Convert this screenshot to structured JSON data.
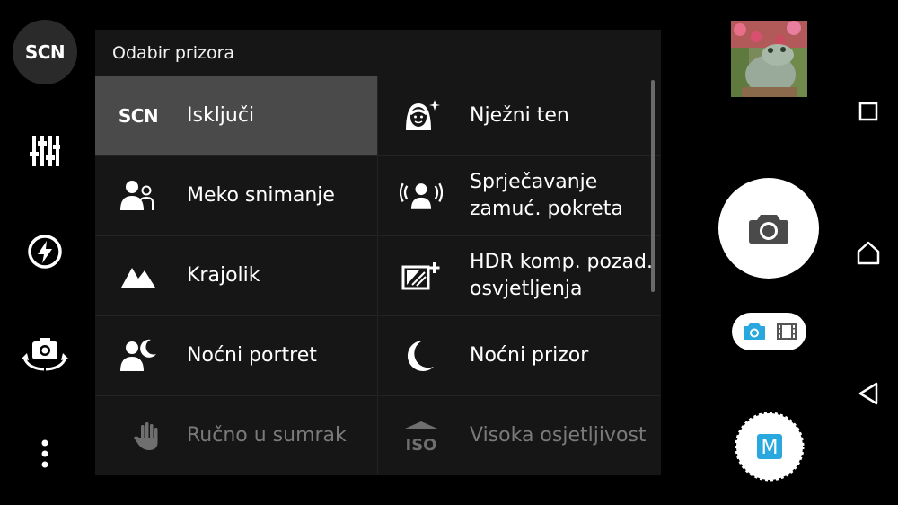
{
  "left_rail": {
    "scene_button_label": "SCN",
    "items": [
      {
        "icon": "sliders-icon"
      },
      {
        "icon": "flash-auto-icon"
      },
      {
        "icon": "switch-camera-icon"
      },
      {
        "icon": "more-vertical-icon"
      }
    ]
  },
  "scene_panel": {
    "title": "Odabir prizora",
    "scenes": [
      {
        "icon": "scn-text-icon",
        "icon_text": "SCN",
        "label": "Isključi",
        "selected": true,
        "enabled": true
      },
      {
        "icon": "soft-skin-icon",
        "label": "Nježni ten",
        "selected": false,
        "enabled": true
      },
      {
        "icon": "soft-snap-icon",
        "label": "Meko snimanje",
        "selected": false,
        "enabled": true
      },
      {
        "icon": "anti-motion-blur-icon",
        "label": "Sprječavanje zamuć. pokreta",
        "selected": false,
        "enabled": true
      },
      {
        "icon": "landscape-icon",
        "label": "Krajolik",
        "selected": false,
        "enabled": true
      },
      {
        "icon": "hdr-backlight-icon",
        "label": "HDR komp. pozad. osvjetljenja",
        "selected": false,
        "enabled": true
      },
      {
        "icon": "night-portrait-icon",
        "label": "Noćni portret",
        "selected": false,
        "enabled": true
      },
      {
        "icon": "night-scene-icon",
        "label": "Noćni prizor",
        "selected": false,
        "enabled": true
      },
      {
        "icon": "handheld-twilight-icon",
        "label": "Ručno u sumrak",
        "selected": false,
        "enabled": false
      },
      {
        "icon": "iso-icon",
        "icon_text": "ISO",
        "label": "Visoka osjetljivost",
        "selected": false,
        "enabled": false
      }
    ]
  },
  "right_controls": {
    "thumbnail": "last-photo-thumbnail",
    "shutter_icon": "camera-icon",
    "mode_toggle": {
      "photo_icon": "photo-mode-icon",
      "video_icon": "video-mode-icon",
      "active": "photo"
    },
    "manual_label": "M"
  },
  "system_nav": [
    "recents-icon",
    "home-icon",
    "back-icon"
  ],
  "colors": {
    "background": "#000000",
    "panel": "#161616",
    "selected_row": "#4a4a4a",
    "accent_blue": "#29a8e0",
    "disabled_text": "#7a7a7a"
  }
}
